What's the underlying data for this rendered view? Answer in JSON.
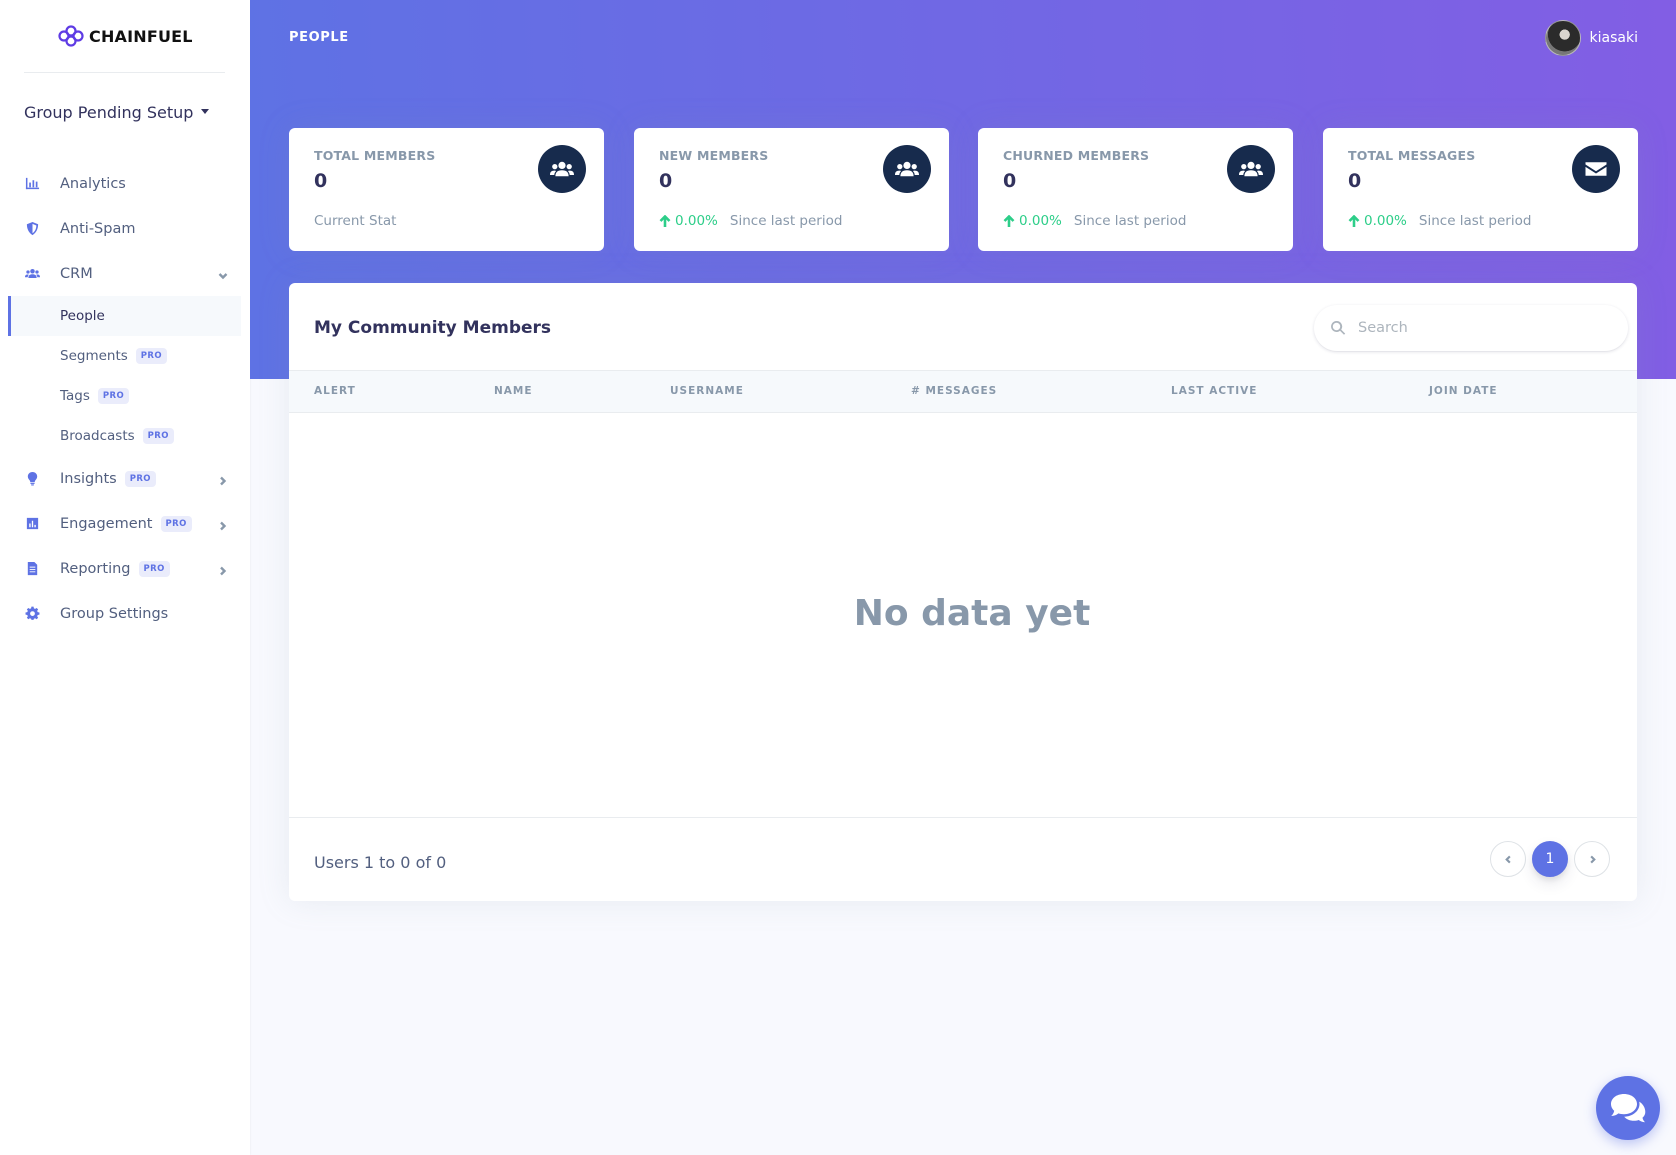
{
  "brand": {
    "name": "CHAINFUEL"
  },
  "group": {
    "selected": "Group Pending Setup"
  },
  "sidebar": {
    "items": [
      {
        "label": "Analytics",
        "icon": "bar-chart-icon"
      },
      {
        "label": "Anti-Spam",
        "icon": "shield-icon"
      },
      {
        "label": "CRM",
        "icon": "users-icon",
        "expanded": true,
        "children": [
          {
            "label": "People",
            "active": true
          },
          {
            "label": "Segments",
            "badge": "PRO"
          },
          {
            "label": "Tags",
            "badge": "PRO"
          },
          {
            "label": "Broadcasts",
            "badge": "PRO"
          }
        ]
      },
      {
        "label": "Insights",
        "icon": "lightbulb-icon",
        "badge": "PRO"
      },
      {
        "label": "Engagement",
        "icon": "poll-icon",
        "badge": "PRO"
      },
      {
        "label": "Reporting",
        "icon": "file-icon",
        "badge": "PRO"
      },
      {
        "label": "Group Settings",
        "icon": "gear-icon"
      }
    ]
  },
  "header": {
    "title": "PEOPLE",
    "username": "kiasaki"
  },
  "stats": [
    {
      "label": "TOTAL MEMBERS",
      "value": "0",
      "footer": "Current Stat",
      "icon": "users-icon"
    },
    {
      "label": "NEW MEMBERS",
      "value": "0",
      "change": "0.00%",
      "footer": "Since last period",
      "icon": "users-icon"
    },
    {
      "label": "CHURNED MEMBERS",
      "value": "0",
      "change": "0.00%",
      "footer": "Since last period",
      "icon": "users-icon"
    },
    {
      "label": "TOTAL MESSAGES",
      "value": "0",
      "change": "0.00%",
      "footer": "Since last period",
      "icon": "envelope-icon"
    }
  ],
  "members_table": {
    "title": "My Community Members",
    "search_placeholder": "Search",
    "columns": [
      "ALERT",
      "NAME",
      "USERNAME",
      "# MESSAGES",
      "LAST ACTIVE",
      "JOIN DATE"
    ],
    "empty_text": "No data yet",
    "count_text": "Users 1 to 0 of 0",
    "pagination": {
      "current": "1"
    }
  },
  "colors": {
    "primary": "#5e72e4",
    "gradient_end": "#825ee4",
    "success": "#2dce89",
    "icon_bg": "#172b4d"
  }
}
